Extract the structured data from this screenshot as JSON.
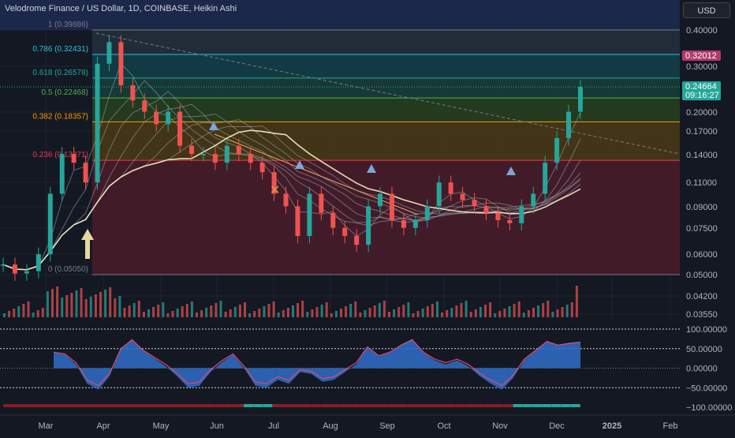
{
  "header": {
    "title": "Velodrome Finance / US Dollar, 1D, COINBASE, Heikin Ashi",
    "currency": "USD"
  },
  "colors": {
    "background": "#141823",
    "grid": "#1e2330",
    "text": "#b2b5be",
    "up": "#26a69a",
    "down": "#ef5350",
    "fib_line": "#2a9ea0",
    "price_badge": "#b03a6a",
    "current_badge": "#26a69a"
  },
  "chart_data": [
    {
      "type": "line",
      "title": "Velodrome Finance / US Dollar, 1D, COINBASE, Heikin Ashi",
      "x_ticks": [
        "Mar",
        "Apr",
        "May",
        "Jun",
        "Jul",
        "Aug",
        "Sep",
        "Oct",
        "Nov",
        "Dec",
        "2025",
        "Feb"
      ],
      "y_scale": "log",
      "y_ticks": [
        "0.40000",
        "0.30000",
        "0.20000",
        "0.17000",
        "0.14000",
        "0.11000",
        "0.09000",
        "0.07500",
        "0.06000",
        "0.05000",
        "0.04200",
        "0.03550"
      ],
      "fib_levels": [
        {
          "label": "1 (0.39886)",
          "value": 0.39886,
          "color": "#787b86"
        },
        {
          "label": "0.786 (0.32431)",
          "value": 0.32431,
          "color": "#26c6da"
        },
        {
          "label": "0.618 (0.26578)",
          "value": 0.26578,
          "color": "#26a69a"
        },
        {
          "label": "0.5 (0.22468)",
          "value": 0.22468,
          "color": "#4caf50"
        },
        {
          "label": "0.382 (0.18357)",
          "value": 0.18357,
          "color": "#ff9800"
        },
        {
          "label": "0.236 (0.13271)",
          "value": 0.13271,
          "color": "#f23645"
        },
        {
          "label": "0 (0.05050)",
          "value": 0.0505,
          "color": "#787b86"
        }
      ],
      "series": [
        {
          "name": "",
          "x": [
            "Feb 18",
            "Feb 26",
            "Mar 5",
            "Mar 10",
            "Mar 14",
            "Mar 17",
            "Mar 19",
            "Mar 21",
            "Mar 24",
            "Mar 27",
            "Apr 1",
            "Apr 8",
            "Apr 15",
            "Apr 22",
            "Apr 28",
            "May 6",
            "May 13",
            "May 20",
            "May 27",
            "Jun 3",
            "Jun 10",
            "Jun 17",
            "Jun 24",
            "Jul 1",
            "Jul 5",
            "Jul 8",
            "Jul 15",
            "Jul 22",
            "Jul 29",
            "Aug 5",
            "Aug 12",
            "Aug 19",
            "Aug 23",
            "Aug 26",
            "Sep 2",
            "Sep 9",
            "Sep 16",
            "Sep 23",
            "Sep 30",
            "Oct 7",
            "Oct 14",
            "Oct 21",
            "Oct 28",
            "Nov 4",
            "Nov 11",
            "Nov 18",
            "Nov 25",
            "Dec 2",
            "Dec 4",
            "Dec 5"
          ],
          "values": [
            0.055,
            0.051,
            0.052,
            0.06,
            0.1,
            0.14,
            0.13,
            0.11,
            0.3,
            0.36,
            0.25,
            0.22,
            0.2,
            0.18,
            0.2,
            0.15,
            0.14,
            0.14,
            0.13,
            0.15,
            0.14,
            0.13,
            0.12,
            0.1,
            0.09,
            0.07,
            0.1,
            0.085,
            0.075,
            0.07,
            0.065,
            0.09,
            0.1,
            0.08,
            0.075,
            0.08,
            0.09,
            0.11,
            0.1,
            0.095,
            0.09,
            0.085,
            0.08,
            0.078,
            0.09,
            0.1,
            0.13,
            0.16,
            0.2,
            0.2466
          ]
        }
      ],
      "price_badges": [
        {
          "label": "0.32012",
          "value": 0.32012,
          "color": "#b03a6a"
        },
        {
          "label": "0.24664",
          "sub": "09:16:27",
          "value": 0.24664,
          "color": "#26a69a"
        }
      ]
    },
    {
      "type": "line",
      "title": "",
      "y_ticks": [
        "100.00000",
        "50.00000",
        "0.00000",
        "−50.00000",
        "−100.00000"
      ],
      "ylim": [
        -100,
        100
      ],
      "series": [
        {
          "name": "",
          "values": [
            40,
            35,
            10,
            -40,
            -55,
            -20,
            50,
            75,
            45,
            25,
            5,
            -20,
            -50,
            -45,
            -10,
            15,
            35,
            0,
            -45,
            -50,
            -30,
            -40,
            -10,
            -15,
            -35,
            -30,
            -10,
            10,
            55,
            30,
            40,
            60,
            75,
            40,
            20,
            10,
            20,
            5,
            -20,
            -40,
            -55,
            -25,
            20,
            45,
            70,
            60,
            65,
            68
          ]
        }
      ]
    }
  ]
}
